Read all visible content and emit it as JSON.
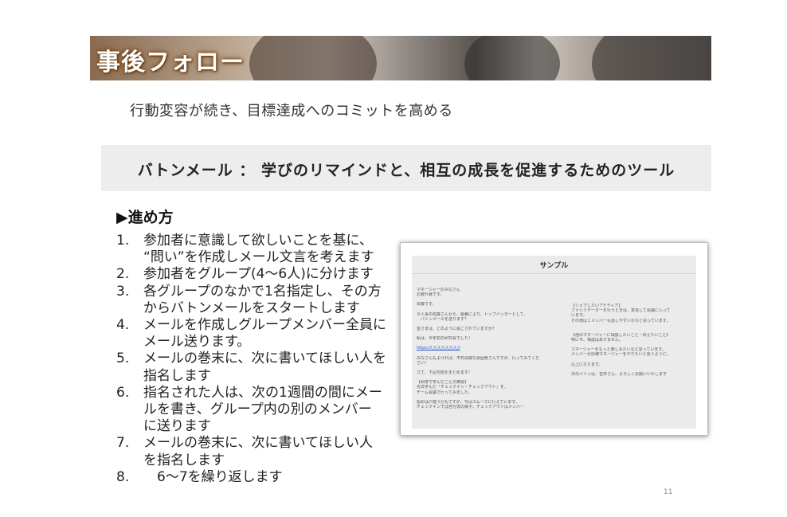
{
  "header": {
    "title": "事後フォロー"
  },
  "subtitle": "行動変容が続き、目標達成へのコミットを高める",
  "highlight": {
    "text": "バトンメール ： 学びのリマインドと、相互の成長を促進するためのツール"
  },
  "section": {
    "heading": "▶進め方"
  },
  "steps": [
    {
      "num": "1.",
      "lines": [
        "参加者に意識して欲しいことを基に、",
        "“問い”を作成しメール文言を考えます"
      ]
    },
    {
      "num": "2.",
      "lines": [
        "参加者をグループ(4〜6人)に分けます"
      ]
    },
    {
      "num": "3.",
      "lines": [
        "各グループのなかで1名指定し、その方",
        "からバトンメールをスタートします"
      ]
    },
    {
      "num": "4.",
      "lines": [
        "メールを作成しグループメンバー全員に",
        "メール送ります。"
      ]
    },
    {
      "num": "5.",
      "lines": [
        "メールの巻末に、次に書いてほしい人を",
        "指名します"
      ]
    },
    {
      "num": "6.",
      "lines": [
        "指名された人は、次の1週間の間にメー",
        "ルを書き、グループ内の別のメンバー",
        "に送ります"
      ]
    },
    {
      "num": "7.",
      "lines": [
        "メールの巻末に、次に書いてほしい人",
        "を指名します"
      ]
    },
    {
      "num": "8.",
      "lines": [
        "　6〜7を繰り返します"
      ]
    }
  ],
  "sample": {
    "title": "サンプル",
    "left_lines": [
      "マネージャーのみなさん",
      "お疲れ様です。",
      "",
      "伝藤です。",
      "",
      "８人事の佐藤さんから、順番により、トップバッターとして、",
      "　バトンメールを送ります？",
      "",
      "皆さまは、どのように過ごされていますか？",
      "",
      "私は、今年初の研究会でした！",
      "",
      "https://〇〇〇〇〇〇〇/",
      "",
      "みなさんもよければ、不的清蔵な雰囲気さんですが、行ってみてくだ",
      "さい！",
      "",
      "さて、下記内容をまとめます！",
      "",
      "【研修で学んだことの実践】",
      "先日学んだ「チェックイン・チェックアウト」を、",
      "チーム会議で行ってみました。",
      "",
      "始めは戸惑うかもですが、今はスムーズに行えています。",
      "チェックインでは自分達の様子。チェックアウトはメンバー"
    ],
    "right_lines": [
      "【シェアしたいアイディア】",
      "ファシリテーターを行うときは、意見して会議に入って",
      "います。",
      "その他は１メンバーも話しやすいかなと思っています。",
      "",
      "",
      "【他のマネージャーに相談したいこと・伝えたいこと】",
      "特に今、相談はありません。",
      "",
      "マネージャーをもっと楽しみたいなと思っています。",
      "メンバーが評価マネージャーをやりたいと思うように。",
      "",
      "以上になります。",
      "",
      "次のバトンは、吉井さん、よろしくお願いいたします"
    ]
  },
  "page_number": "11"
}
